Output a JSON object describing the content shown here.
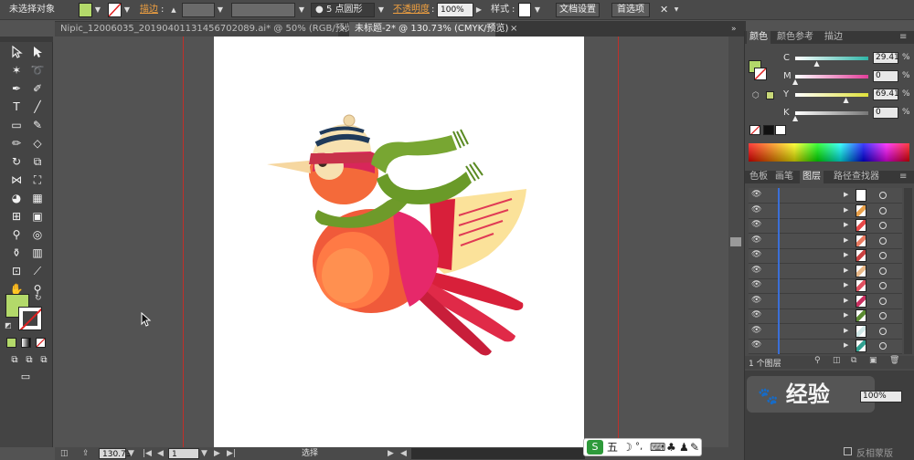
{
  "control_bar": {
    "selection_label": "未选择对象",
    "fill_color": "#b3d96a",
    "stroke_label": "描边",
    "brush_label": "5 点圆形",
    "opacity_label": "不透明度",
    "opacity_value": "100%",
    "style_label": "样式",
    "doc_settings_button": "文档设置",
    "preferences_button": "首选项"
  },
  "document_tabs": [
    {
      "label": "Nipic_12006035_20190401131456702089.ai* @ 50% (RGB/预览)",
      "close": "×"
    },
    {
      "label": "未标题-2* @ 130.73% (CMYK/预览)",
      "close": "×"
    }
  ],
  "tools": {
    "selection": "selection-arrow-icon",
    "direct_selection": "direct-selection-icon",
    "type_label": "T",
    "fill_swatch_color": "#b3d96a",
    "stroke_swatch_color": "#ffffff"
  },
  "status_bar": {
    "zoom_value": "130.73",
    "page_value": "1",
    "mode_label": "选择"
  },
  "ime_bar": {
    "label": "五"
  },
  "color_panel": {
    "tabs": [
      "颜色",
      "颜色参考",
      "描边"
    ],
    "sliders": [
      {
        "channel": "C",
        "value": "29.41",
        "level": 29.41,
        "track": "#2fb5a7"
      },
      {
        "channel": "M",
        "value": "0",
        "level": 0,
        "track": "#e23f9a"
      },
      {
        "channel": "Y",
        "value": "69.41",
        "level": 69.41,
        "track": "#e0e23a"
      },
      {
        "channel": "K",
        "value": "0",
        "level": 0,
        "track": "#777777"
      }
    ],
    "percent_sign": "%"
  },
  "layers_panel": {
    "tabs": [
      "色板",
      "画笔",
      "图层",
      "路径查找器"
    ],
    "layer_count_label": "1 个图层",
    "row_thumbs": [
      "#ffffff",
      "#e8a04a",
      "#e84848",
      "#e87a60",
      "#c94040",
      "#e8b888",
      "#e05060",
      "#c83060",
      "#5a8a30",
      "#d0e8e8",
      "#30a090"
    ]
  },
  "bottom_panel": {
    "hint_text": "反相蒙版",
    "zoom_field": "100%",
    "logo_text": "经验"
  }
}
